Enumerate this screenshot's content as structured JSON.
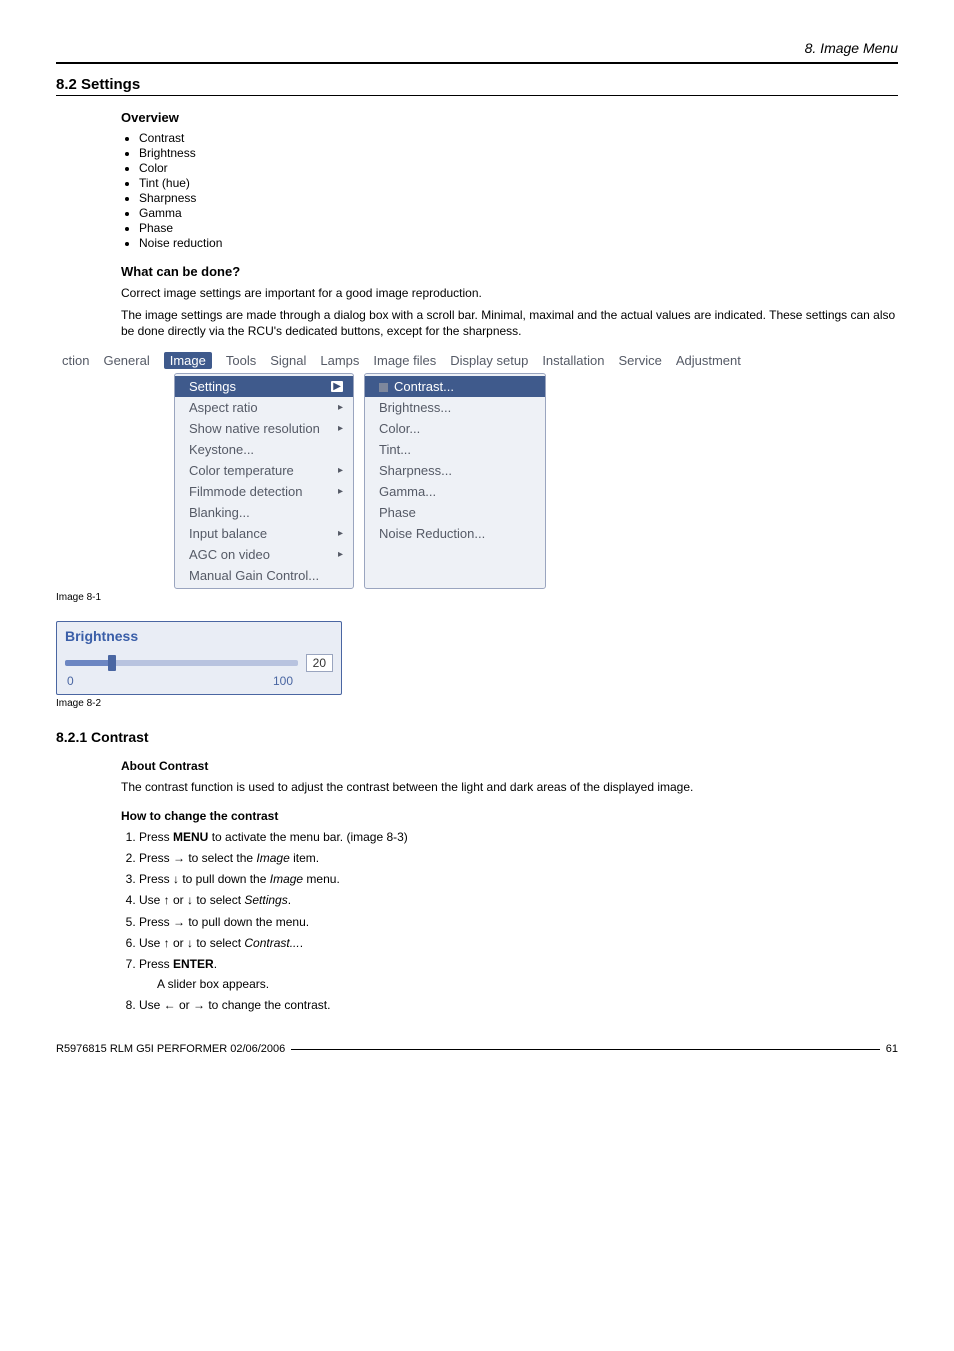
{
  "header": {
    "right": "8.  Image Menu"
  },
  "section": {
    "number_title": "8.2   Settings"
  },
  "overview": {
    "heading": "Overview",
    "items": [
      "Contrast",
      "Brightness",
      "Color",
      "Tint (hue)",
      "Sharpness",
      "Gamma",
      "Phase",
      "Noise reduction"
    ]
  },
  "what": {
    "heading": "What can be done?",
    "p1": "Correct image settings are important for a good image reproduction.",
    "p2": "The image settings are made through a dialog box with a scroll bar. Minimal, maximal and the actual values are indicated. These settings can also be done directly via the RCU's dedicated buttons, except for the sharpness."
  },
  "menubar": {
    "items": [
      "ction",
      "General",
      "Image",
      "Tools",
      "Signal",
      "Lamps",
      "Image files",
      "Display setup",
      "Installation",
      "Service",
      "Adjustment"
    ],
    "active": "Image"
  },
  "dropdown1": [
    {
      "label": "Settings",
      "arrow": true,
      "sel": true
    },
    {
      "label": "Aspect ratio",
      "arrow": true
    },
    {
      "label": "Show native resolution",
      "arrow": true
    },
    {
      "label": "Keystone..."
    },
    {
      "label": "Color temperature",
      "arrow": true
    },
    {
      "label": "Filmmode detection",
      "arrow": true
    },
    {
      "label": "Blanking..."
    },
    {
      "label": "Input balance",
      "arrow": true
    },
    {
      "label": "AGC on video",
      "arrow": true
    },
    {
      "label": "Manual Gain Control..."
    }
  ],
  "dropdown2": [
    {
      "label": "Contrast...",
      "sel": true,
      "square": true
    },
    {
      "label": "Brightness..."
    },
    {
      "label": "Color..."
    },
    {
      "label": "Tint..."
    },
    {
      "label": "Sharpness..."
    },
    {
      "label": "Gamma..."
    },
    {
      "label": "Phase"
    },
    {
      "label": "Noise Reduction..."
    }
  ],
  "captions": {
    "img1": "Image 8-1",
    "img2": "Image 8-2"
  },
  "slider": {
    "title": "Brightness",
    "min": "0",
    "max": "100",
    "value": "20"
  },
  "subsection": {
    "number_title": "8.2.1   Contrast"
  },
  "about": {
    "heading": "About Contrast",
    "p": "The contrast function is used to adjust the contrast between the light and dark areas of the displayed image."
  },
  "howto": {
    "heading": "How to change the contrast",
    "s1a": "Press ",
    "s1b": "MENU",
    "s1c": " to activate the menu bar. (image 8-3)",
    "s2a": "Press → to select the ",
    "s2b": "Image",
    "s2c": " item.",
    "s3a": "Press ↓ to pull down the ",
    "s3b": "Image",
    "s3c": " menu.",
    "s4a": "Use ↑ or ↓ to select ",
    "s4b": "Settings",
    "s4c": ".",
    "s5": "Press → to pull down the menu.",
    "s6a": "Use ↑ or ↓ to select ",
    "s6b": "Contrast...",
    "s6c": ".",
    "s7a": "Press ",
    "s7b": "ENTER",
    "s7c": ".",
    "s7note": "A slider box appears.",
    "s8": "Use ← or → to change the contrast."
  },
  "footer": {
    "left": "R5976815  RLM G5I PERFORMER  02/06/2006",
    "right": "61"
  }
}
